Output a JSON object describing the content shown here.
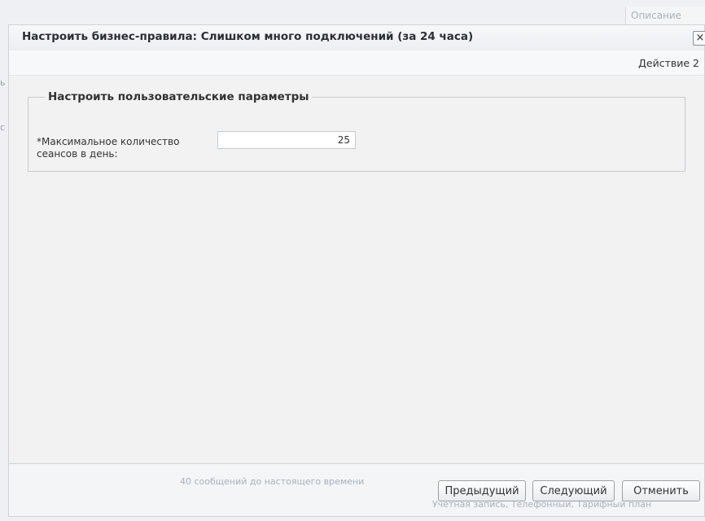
{
  "background": {
    "column_header": "Описание",
    "rows": [
      "40 сообщений до настоящего времени",
      "Учетная запись, Телефонный, Тарифный план"
    ]
  },
  "modal": {
    "title": "Настроить бизнес-правила: Слишком много подключений (за 24 часа)",
    "close_label": "×",
    "step_label": "Действие 2",
    "fieldset_legend": "Настроить пользовательские параметры",
    "field": {
      "label": "*Максимальное количество сеансов в день:",
      "value": "25"
    },
    "buttons": {
      "prev": "Предыдущий",
      "next": "Следующий",
      "cancel": "Отменить"
    }
  }
}
